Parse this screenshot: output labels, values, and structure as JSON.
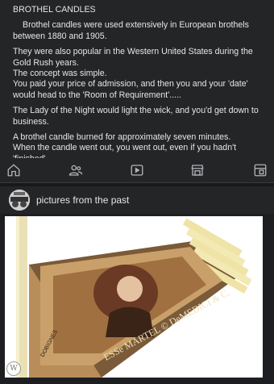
{
  "post": {
    "title": "BROTHEL CANDLES",
    "para1": "Brothel candles were used extensively in European brothels between 1880 and 1905.",
    "para2": "They were also popular in the Western United States during the Gold Rush years.",
    "para3": "The concept was simple.",
    "para4": "You paid your price of admission, and then you and your 'date' would head to the 'Room of Requirement'.....",
    "para5": " The Lady of the Night would light the wick, and you'd get down to business.",
    "para6": "A brothel candle burned for approximately seven minutes.",
    "para7": "When the candle went out, you went out, even if you hadn't 'finished'",
    "emoji": "laughing-emoji"
  },
  "nav": {
    "icons": [
      "home-icon",
      "friends-icon",
      "video-icon",
      "marketplace-icon",
      "feeds-icon"
    ]
  },
  "page": {
    "name": "pictures from the past"
  },
  "photo": {
    "box_label_left": "DOBIGNES",
    "box_label_main": "ESSe MARTEL © DeMEDICI & C.",
    "watermark": "W"
  },
  "colors": {
    "background": "#1c1e21",
    "card": "#242526",
    "text": "#e4e6eb"
  }
}
